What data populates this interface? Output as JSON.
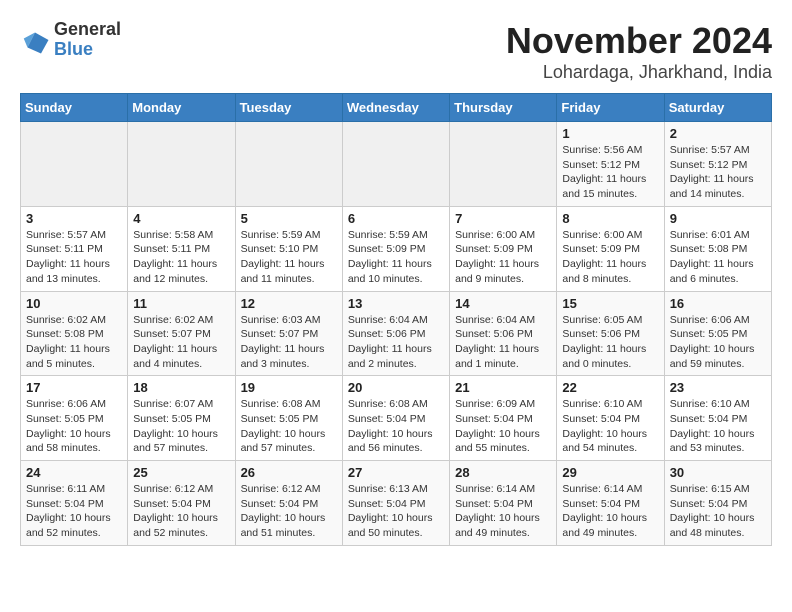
{
  "header": {
    "logo_general": "General",
    "logo_blue": "Blue",
    "title": "November 2024",
    "subtitle": "Lohardaga, Jharkhand, India"
  },
  "calendar": {
    "headers": [
      "Sunday",
      "Monday",
      "Tuesday",
      "Wednesday",
      "Thursday",
      "Friday",
      "Saturday"
    ],
    "weeks": [
      [
        {
          "day": "",
          "info": ""
        },
        {
          "day": "",
          "info": ""
        },
        {
          "day": "",
          "info": ""
        },
        {
          "day": "",
          "info": ""
        },
        {
          "day": "",
          "info": ""
        },
        {
          "day": "1",
          "info": "Sunrise: 5:56 AM\nSunset: 5:12 PM\nDaylight: 11 hours\nand 15 minutes."
        },
        {
          "day": "2",
          "info": "Sunrise: 5:57 AM\nSunset: 5:12 PM\nDaylight: 11 hours\nand 14 minutes."
        }
      ],
      [
        {
          "day": "3",
          "info": "Sunrise: 5:57 AM\nSunset: 5:11 PM\nDaylight: 11 hours\nand 13 minutes."
        },
        {
          "day": "4",
          "info": "Sunrise: 5:58 AM\nSunset: 5:11 PM\nDaylight: 11 hours\nand 12 minutes."
        },
        {
          "day": "5",
          "info": "Sunrise: 5:59 AM\nSunset: 5:10 PM\nDaylight: 11 hours\nand 11 minutes."
        },
        {
          "day": "6",
          "info": "Sunrise: 5:59 AM\nSunset: 5:09 PM\nDaylight: 11 hours\nand 10 minutes."
        },
        {
          "day": "7",
          "info": "Sunrise: 6:00 AM\nSunset: 5:09 PM\nDaylight: 11 hours\nand 9 minutes."
        },
        {
          "day": "8",
          "info": "Sunrise: 6:00 AM\nSunset: 5:09 PM\nDaylight: 11 hours\nand 8 minutes."
        },
        {
          "day": "9",
          "info": "Sunrise: 6:01 AM\nSunset: 5:08 PM\nDaylight: 11 hours\nand 6 minutes."
        }
      ],
      [
        {
          "day": "10",
          "info": "Sunrise: 6:02 AM\nSunset: 5:08 PM\nDaylight: 11 hours\nand 5 minutes."
        },
        {
          "day": "11",
          "info": "Sunrise: 6:02 AM\nSunset: 5:07 PM\nDaylight: 11 hours\nand 4 minutes."
        },
        {
          "day": "12",
          "info": "Sunrise: 6:03 AM\nSunset: 5:07 PM\nDaylight: 11 hours\nand 3 minutes."
        },
        {
          "day": "13",
          "info": "Sunrise: 6:04 AM\nSunset: 5:06 PM\nDaylight: 11 hours\nand 2 minutes."
        },
        {
          "day": "14",
          "info": "Sunrise: 6:04 AM\nSunset: 5:06 PM\nDaylight: 11 hours\nand 1 minute."
        },
        {
          "day": "15",
          "info": "Sunrise: 6:05 AM\nSunset: 5:06 PM\nDaylight: 11 hours\nand 0 minutes."
        },
        {
          "day": "16",
          "info": "Sunrise: 6:06 AM\nSunset: 5:05 PM\nDaylight: 10 hours\nand 59 minutes."
        }
      ],
      [
        {
          "day": "17",
          "info": "Sunrise: 6:06 AM\nSunset: 5:05 PM\nDaylight: 10 hours\nand 58 minutes."
        },
        {
          "day": "18",
          "info": "Sunrise: 6:07 AM\nSunset: 5:05 PM\nDaylight: 10 hours\nand 57 minutes."
        },
        {
          "day": "19",
          "info": "Sunrise: 6:08 AM\nSunset: 5:05 PM\nDaylight: 10 hours\nand 57 minutes."
        },
        {
          "day": "20",
          "info": "Sunrise: 6:08 AM\nSunset: 5:04 PM\nDaylight: 10 hours\nand 56 minutes."
        },
        {
          "day": "21",
          "info": "Sunrise: 6:09 AM\nSunset: 5:04 PM\nDaylight: 10 hours\nand 55 minutes."
        },
        {
          "day": "22",
          "info": "Sunrise: 6:10 AM\nSunset: 5:04 PM\nDaylight: 10 hours\nand 54 minutes."
        },
        {
          "day": "23",
          "info": "Sunrise: 6:10 AM\nSunset: 5:04 PM\nDaylight: 10 hours\nand 53 minutes."
        }
      ],
      [
        {
          "day": "24",
          "info": "Sunrise: 6:11 AM\nSunset: 5:04 PM\nDaylight: 10 hours\nand 52 minutes."
        },
        {
          "day": "25",
          "info": "Sunrise: 6:12 AM\nSunset: 5:04 PM\nDaylight: 10 hours\nand 52 minutes."
        },
        {
          "day": "26",
          "info": "Sunrise: 6:12 AM\nSunset: 5:04 PM\nDaylight: 10 hours\nand 51 minutes."
        },
        {
          "day": "27",
          "info": "Sunrise: 6:13 AM\nSunset: 5:04 PM\nDaylight: 10 hours\nand 50 minutes."
        },
        {
          "day": "28",
          "info": "Sunrise: 6:14 AM\nSunset: 5:04 PM\nDaylight: 10 hours\nand 49 minutes."
        },
        {
          "day": "29",
          "info": "Sunrise: 6:14 AM\nSunset: 5:04 PM\nDaylight: 10 hours\nand 49 minutes."
        },
        {
          "day": "30",
          "info": "Sunrise: 6:15 AM\nSunset: 5:04 PM\nDaylight: 10 hours\nand 48 minutes."
        }
      ]
    ]
  }
}
